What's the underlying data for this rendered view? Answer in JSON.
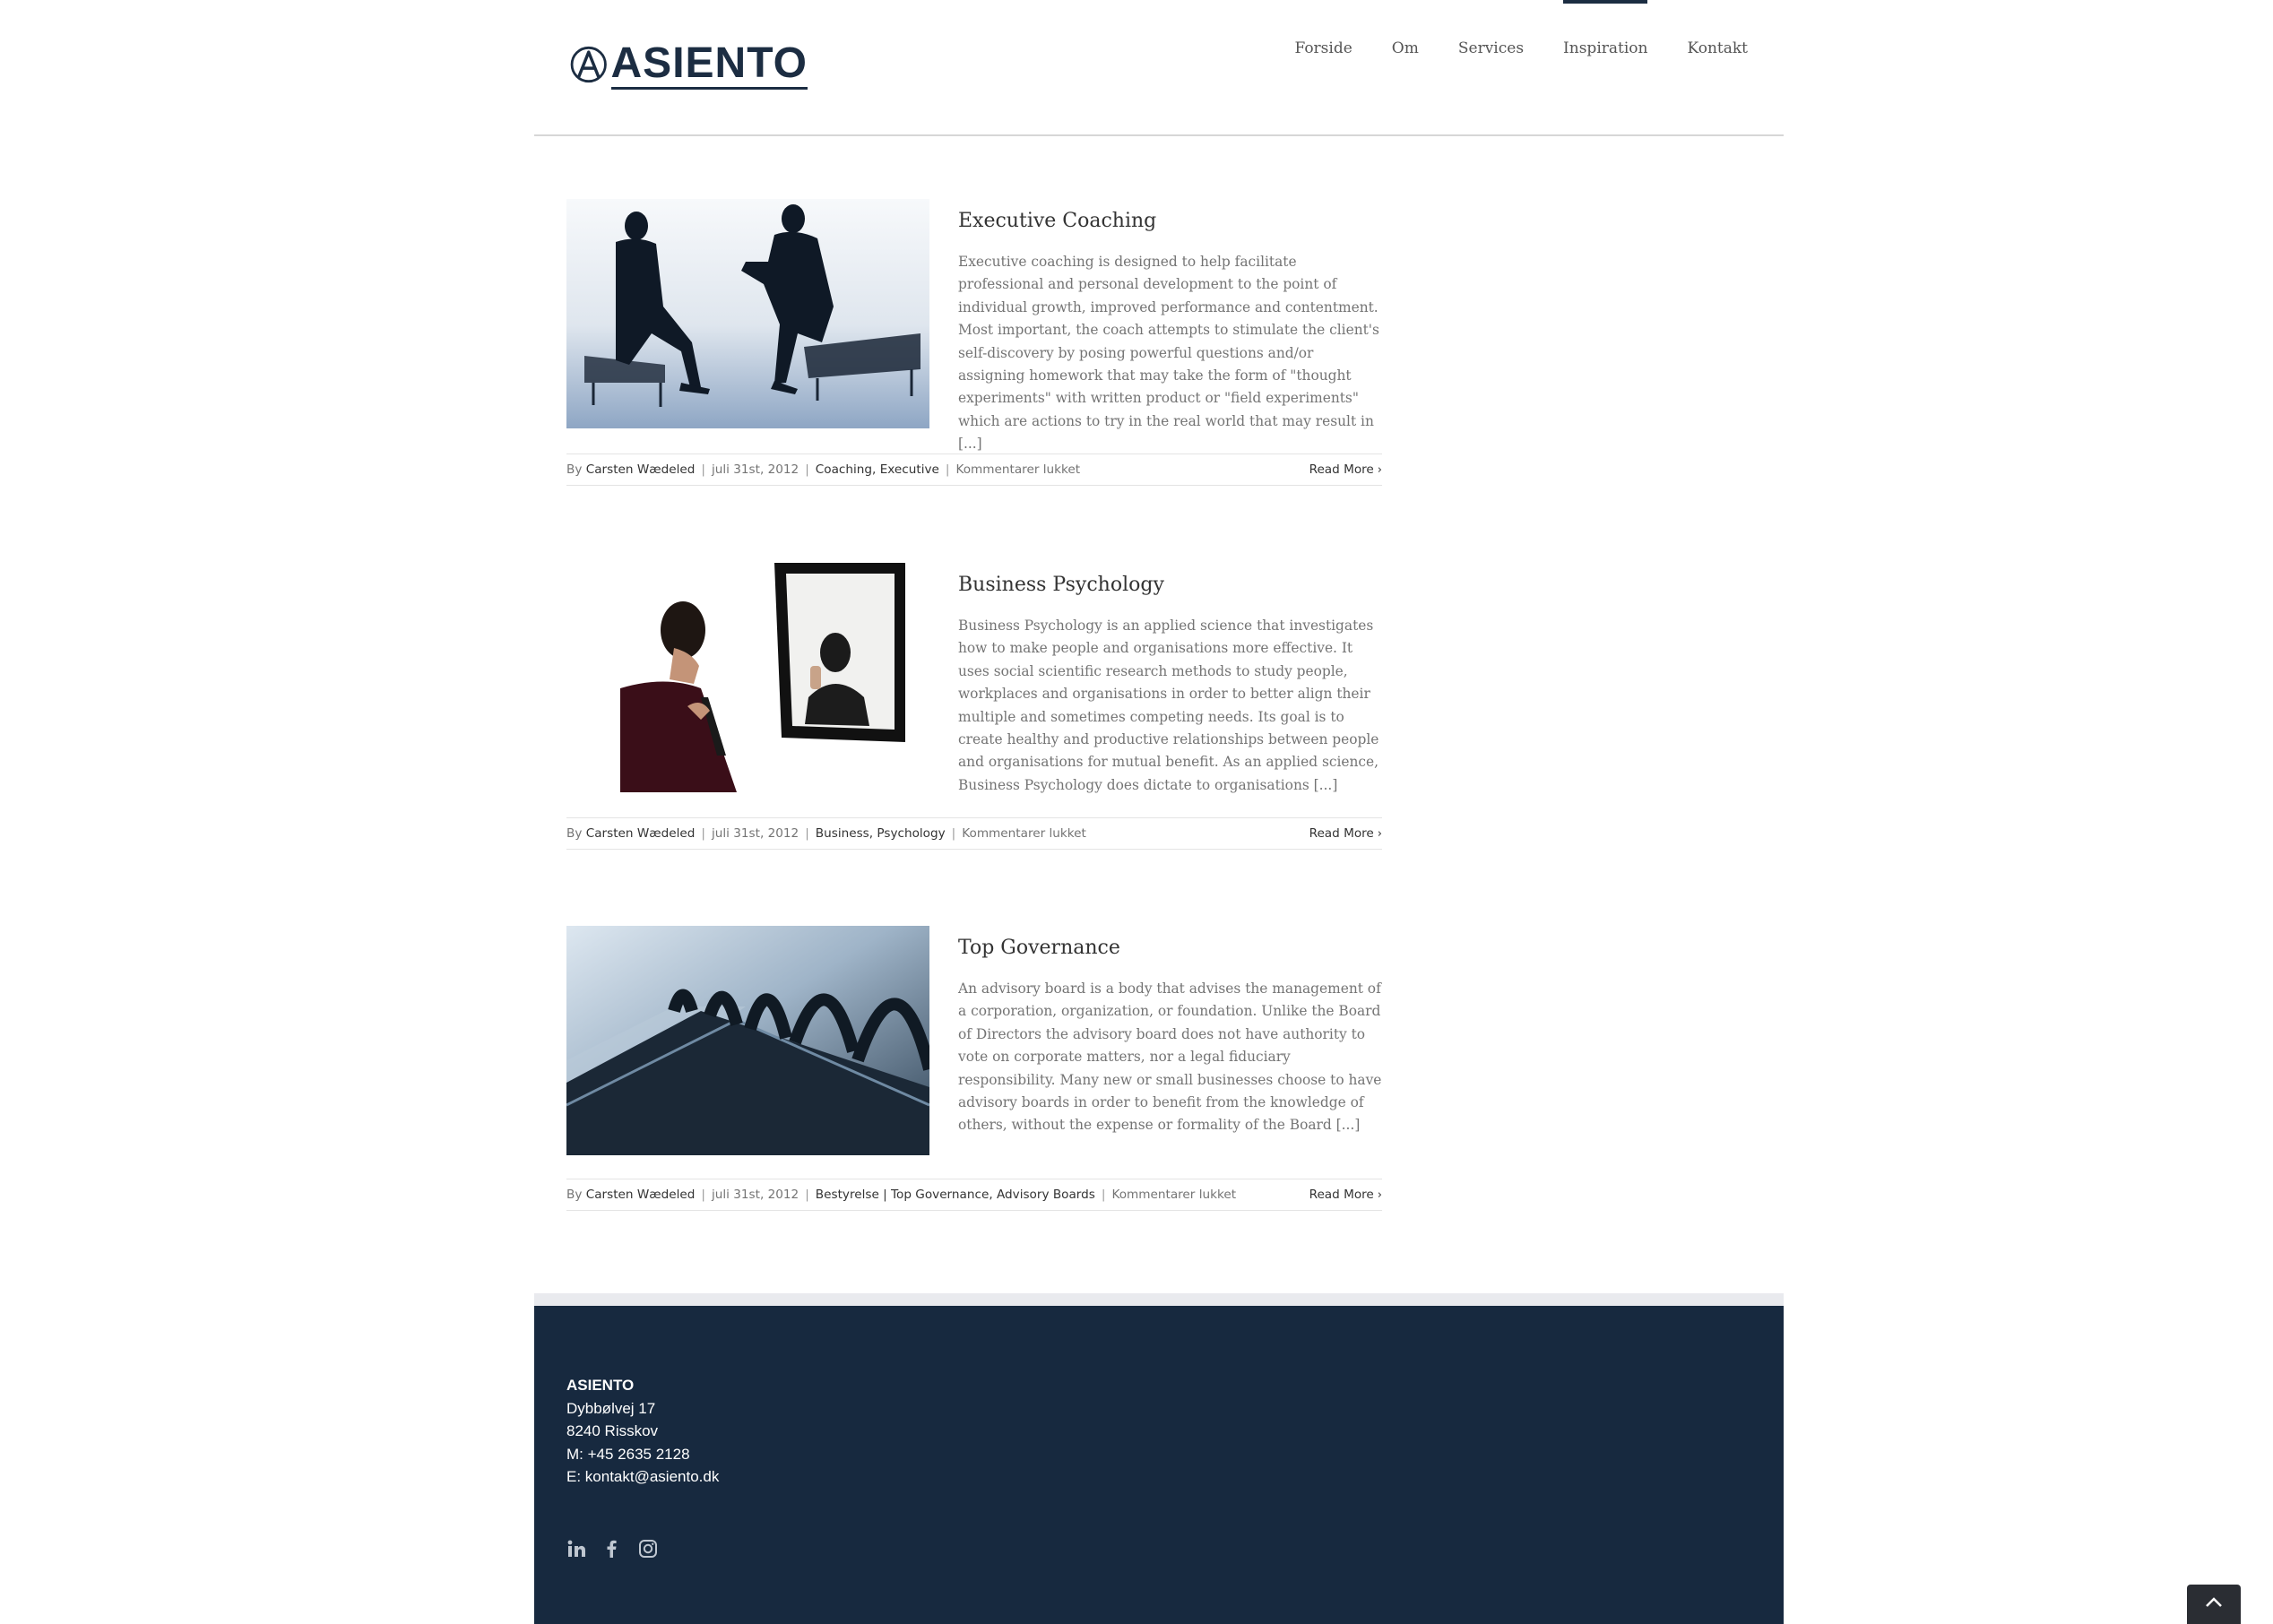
{
  "brand": {
    "name": "ASIENTO",
    "logo_letter": "A",
    "color": "#1c2d42"
  },
  "nav": {
    "items": [
      {
        "label": "Forside",
        "active": false
      },
      {
        "label": "Om",
        "active": false
      },
      {
        "label": "Services",
        "active": false
      },
      {
        "label": "Inspiration",
        "active": true
      },
      {
        "label": "Kontakt",
        "active": false
      }
    ]
  },
  "posts": [
    {
      "title": "Executive Coaching",
      "excerpt": "Executive coaching is designed to help facilitate professional and personal development to the point of individual growth, improved performance and contentment. Most important, the coach attempts to stimulate the client's self-discovery by posing powerful questions and/or assigning homework that may take the form of \"thought experiments\" with written product or \"field experiments\" which are actions to try in the real world that may result in [...]",
      "by": "By",
      "author": "Carsten Wædeled",
      "date": "juli 31st, 2012",
      "cat1": "Coaching",
      "cat2": "Executive",
      "comments": "Kommentarer lukket",
      "read_more": "Read More"
    },
    {
      "title": "Business Psychology",
      "excerpt": "Business Psychology is an applied science that investigates how to make people and organisations more effective. It uses social scientific research methods to study people, workplaces and organisations in order to better align their multiple and sometimes competing needs. Its goal is to create healthy and productive relationships between people and organisations for mutual benefit. As an applied science, Business Psychology does dictate to organisations [...]",
      "by": "By",
      "author": "Carsten Wædeled",
      "date": "juli 31st, 2012",
      "cat1": "Business",
      "cat2": "Psychology",
      "comments": "Kommentarer lukket",
      "read_more": "Read More"
    },
    {
      "title": "Top Governance",
      "excerpt": "An advisory board is a body that advises the management of a corporation, organization, or foundation. Unlike the Board of Directors the advisory board does not have authority to vote on corporate matters, nor a legal fiduciary responsibility. Many new or small businesses choose to have advisory boards in order to benefit from the knowledge of others, without the expense or formality of the Board [...]",
      "by": "By",
      "author": "Carsten Wædeled",
      "date": "juli 31st, 2012",
      "cat1": "Bestyrelse | Top Governance",
      "cat2": "Advisory Boards",
      "comments": "Kommentarer lukket",
      "read_more": "Read More"
    }
  ],
  "footer": {
    "company": "ASIENTO",
    "street": "Dybbølvej 17",
    "city": "8240 Risskov",
    "phone": "M: +45 2635 2128",
    "email": "E: kontakt@asiento.dk",
    "social": [
      "linkedin-icon",
      "facebook-icon",
      "instagram-icon"
    ],
    "background": "#17293f"
  }
}
